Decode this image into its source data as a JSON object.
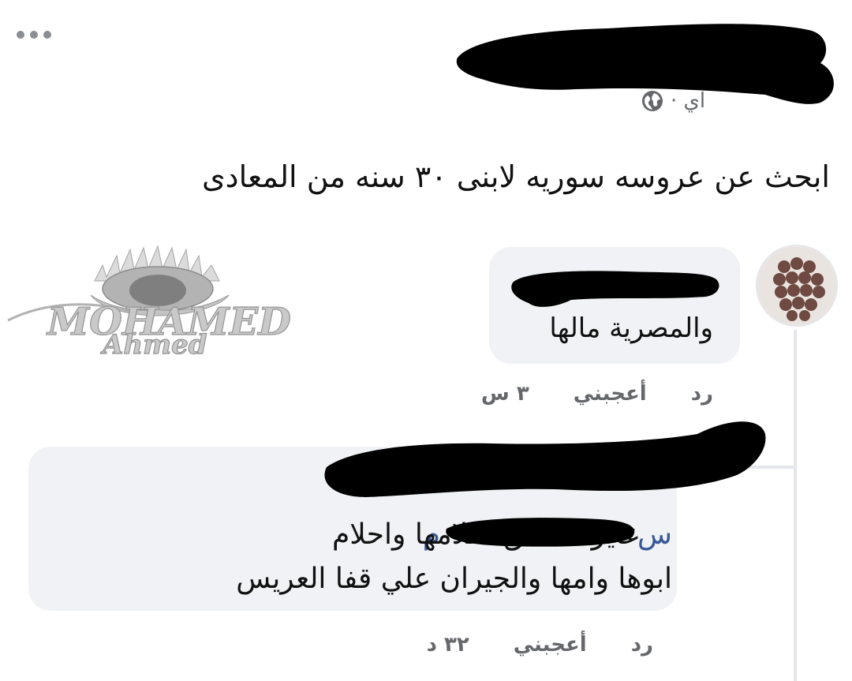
{
  "header": {
    "more_icon": "more-dots-icon",
    "meta_text": "اي ·",
    "privacy_icon": "globe-icon"
  },
  "post": {
    "text": "ابحث عن عروسه سوريه لابنى ٣٠ سنه من المعادى"
  },
  "comments": [
    {
      "text": "والمصرية مالها",
      "time": "٣ س",
      "like_label": "أعجبني",
      "reply_label": "رد"
    },
    {
      "mention_start": "م",
      "mention_end": "س",
      "text_line1": "عايزه تحقق احلامها واحلام",
      "text_line2": "ابوها وامها والجيران  علي قفا العريس",
      "time": "٣٢ د",
      "like_label": "أعجبني",
      "reply_label": "رد"
    }
  ],
  "watermark": {
    "line1": "MOHAMED",
    "line2": "Ahmed"
  },
  "colors": {
    "bubble": "#f0f2f5",
    "meta": "#65676b",
    "mention": "#385898",
    "redaction": "#000000"
  }
}
